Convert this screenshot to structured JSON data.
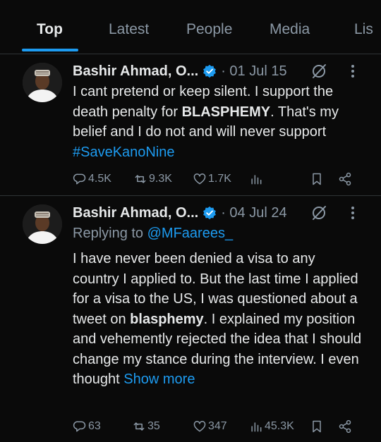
{
  "tabs": [
    {
      "label": "Top",
      "active": true
    },
    {
      "label": "Latest",
      "active": false
    },
    {
      "label": "People",
      "active": false
    },
    {
      "label": "Media",
      "active": false
    },
    {
      "label": "Lis",
      "active": false
    }
  ],
  "colors": {
    "background": "#0a0a0a",
    "text": "#e7e9ea",
    "muted": "#8b98a5",
    "accent": "#1d9bf0"
  },
  "tweets": [
    {
      "author": "Bashir Ahmad, O...",
      "date": "· 01 Jul 15",
      "body": {
        "p1": "I cant pretend or keep silent. I support the death penalty for ",
        "b1": "BLASPHEMY",
        "p2": ". That's my belief and I do not and will never support ",
        "hashtag": "#SaveKanoNine"
      },
      "stats": {
        "replies": "4.5K",
        "reposts": "9.3K",
        "likes": "1.7K",
        "views": ""
      }
    },
    {
      "author": "Bashir Ahmad, O...",
      "date": "· 04 Jul 24",
      "replying_to_prefix": "Replying to ",
      "replying_to_handle": "@MFaarees_",
      "body": {
        "p1": "I have never been denied a visa to any country I applied to. But the last time I applied for a visa to the US, I was questioned about a tweet on ",
        "b1": "blasphemy",
        "p2": ". I explained my position and vehemently rejected the idea that I should change my stance during the interview. I even thought ",
        "show_more": "Show more"
      },
      "stats": {
        "replies": "63",
        "reposts": "35",
        "likes": "347",
        "views": "45.3K"
      }
    }
  ],
  "icons": [
    "verified-badge-icon",
    "grok-icon",
    "more-icon",
    "reply-icon",
    "repost-icon",
    "like-icon",
    "views-icon",
    "bookmark-icon",
    "share-icon"
  ]
}
